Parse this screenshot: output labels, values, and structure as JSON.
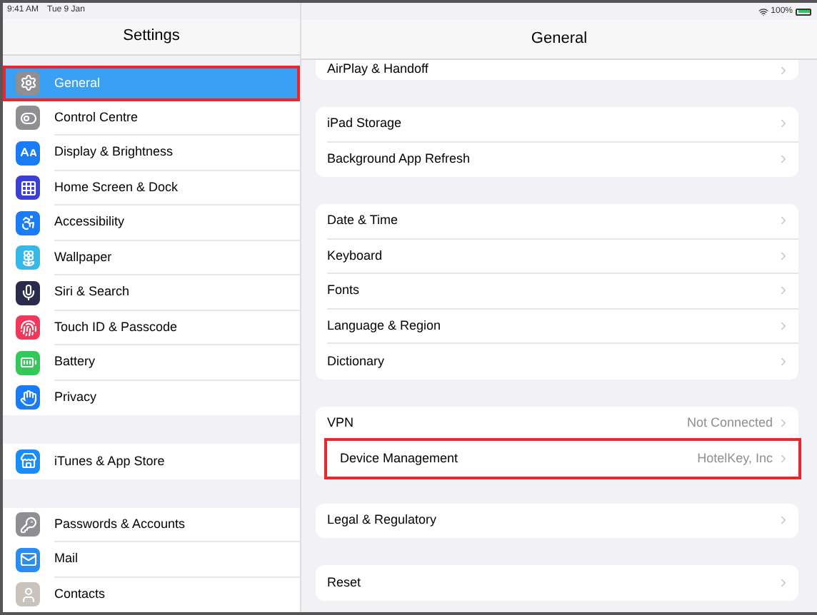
{
  "status_bar": {
    "time": "9:41 AM",
    "date": "Tue 9 Jan",
    "battery": "100%"
  },
  "sidebar": {
    "title": "Settings",
    "groups": [
      [
        {
          "label": "General",
          "selected": true,
          "highlighted": true,
          "color": "#8e8e93"
        },
        {
          "label": "Control Centre",
          "selected": false,
          "highlighted": false,
          "color": "#8e8e93"
        },
        {
          "label": "Display & Brightness",
          "selected": false,
          "highlighted": false,
          "color": "#1a7cf5"
        },
        {
          "label": "Home Screen & Dock",
          "selected": false,
          "highlighted": false,
          "color": "#3c3fd1"
        },
        {
          "label": "Accessibility",
          "selected": false,
          "highlighted": false,
          "color": "#1a7cf5"
        },
        {
          "label": "Wallpaper",
          "selected": false,
          "highlighted": false,
          "color": "#35b9e6"
        },
        {
          "label": "Siri & Search",
          "selected": false,
          "highlighted": false,
          "color": "#2a2a4a"
        },
        {
          "label": "Touch ID & Passcode",
          "selected": false,
          "highlighted": false,
          "color": "#f0385a"
        },
        {
          "label": "Battery",
          "selected": false,
          "highlighted": false,
          "color": "#34c759"
        },
        {
          "label": "Privacy",
          "selected": false,
          "highlighted": false,
          "color": "#1a7cf5"
        }
      ],
      [
        {
          "label": "iTunes & App Store",
          "selected": false,
          "highlighted": false,
          "color": "#1a8cf5"
        }
      ],
      [
        {
          "label": "Passwords & Accounts",
          "selected": false,
          "highlighted": false,
          "color": "#8e8e93"
        },
        {
          "label": "Mail",
          "selected": false,
          "highlighted": false,
          "color": "#2a8cf0"
        },
        {
          "label": "Contacts",
          "selected": false,
          "highlighted": false,
          "color": "#c8c4bc"
        }
      ]
    ]
  },
  "detail": {
    "title": "General",
    "groups": [
      [
        {
          "label": "AirPlay & Handoff",
          "highlighted": false
        }
      ],
      [
        {
          "label": "iPad Storage",
          "highlighted": false
        },
        {
          "label": "Background App Refresh",
          "highlighted": false
        }
      ],
      [
        {
          "label": "Date & Time",
          "highlighted": false
        },
        {
          "label": "Keyboard",
          "highlighted": false
        },
        {
          "label": "Fonts",
          "highlighted": false
        },
        {
          "label": "Language & Region",
          "highlighted": false
        },
        {
          "label": "Dictionary",
          "highlighted": false
        }
      ],
      [
        {
          "label": "VPN",
          "value": "Not Connected",
          "highlighted": false
        },
        {
          "label": "Device Management",
          "value": "HotelKey, Inc",
          "highlighted": true
        }
      ],
      [
        {
          "label": "Legal & Regulatory",
          "highlighted": false
        }
      ],
      [
        {
          "label": "Reset",
          "highlighted": false
        }
      ]
    ]
  }
}
